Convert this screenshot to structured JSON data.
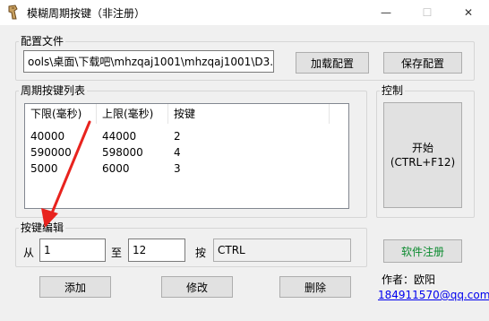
{
  "window": {
    "title": "模糊周期按键（非注册）",
    "minimize_icon": "—",
    "maximize_icon": "☐",
    "close_icon": "✕"
  },
  "config": {
    "group_label": "配置文件",
    "path_value": "ools\\桌面\\下载吧\\mhzqaj1001\\mhzqaj1001\\D3.ini",
    "load_button": "加载配置",
    "save_button": "保存配置"
  },
  "key_list": {
    "group_label": "周期按键列表",
    "columns": [
      "下限(毫秒)",
      "上限(毫秒)",
      "按键"
    ],
    "rows": [
      [
        "40000",
        "44000",
        "2"
      ],
      [
        "590000",
        "598000",
        "4"
      ],
      [
        "5000",
        "6000",
        "3"
      ]
    ]
  },
  "control": {
    "group_label": "控制",
    "start_label": "开始",
    "start_hotkey": "(CTRL+F12)",
    "register_button": "软件注册"
  },
  "key_edit": {
    "group_label": "按键编辑",
    "from_label": "从",
    "from_value": "1",
    "to_label": "至",
    "to_value": "12",
    "key_label": "按",
    "key_value": "CTRL",
    "add_button": "添加",
    "modify_button": "修改",
    "delete_button": "删除"
  },
  "author": {
    "label": "作者：欧阳",
    "contact": "184911570@qq.com"
  },
  "colors": {
    "register_text": "#0a8a2e",
    "link": "#0000ee",
    "annotation_arrow": "#e8231e"
  }
}
